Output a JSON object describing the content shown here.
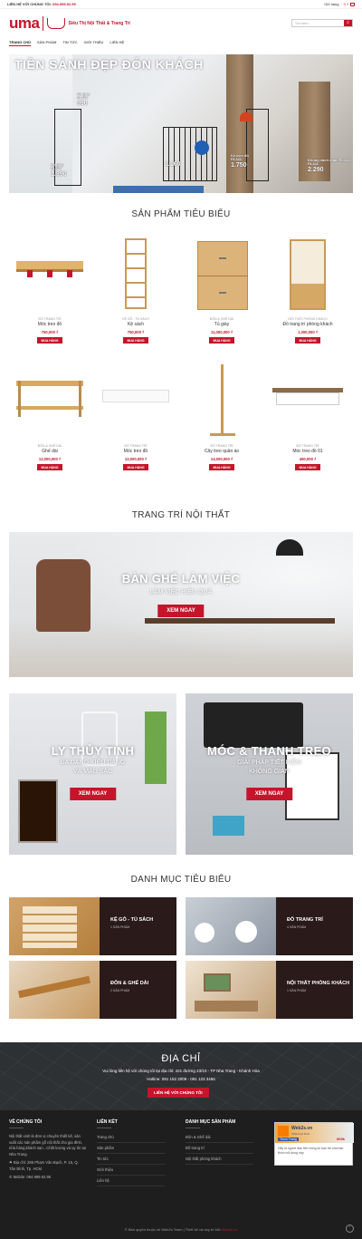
{
  "topbar": {
    "contact_label": "LIÊN HỆ VỚI CHÚNG TÔI:",
    "phone": "094.999.92.95",
    "cart_label": "Giỏ hàng",
    "cart_sep": "/",
    "cart_total": "0 ₫"
  },
  "header": {
    "logo": "uma",
    "tagline": "Siêu Thị Nội Thất & Trang Trí",
    "search_placeholder": "Tìm kiếm..."
  },
  "nav": {
    "items": [
      "TRANG CHỦ",
      "SẢN PHẨM",
      "TIN TỨC",
      "GIỚI THIỆU",
      "LIÊN HỆ"
    ]
  },
  "hero": {
    "title": "TIỀN SẢNH ĐẸP ĐÓN KHÁCH",
    "tags": [
      {
        "line1": "Kệ giày",
        "line2": "RL341",
        "price": "990"
      },
      {
        "line1": "Kệ giày",
        "line2": "RL341",
        "price": "1.390"
      },
      {
        "line1": "",
        "line2": "",
        "price": "1.160"
      },
      {
        "line1": "Kệ treo đồ",
        "line2": "RL341",
        "price": "1.750"
      },
      {
        "line1": "Khung vách ngăn RL341",
        "line2": "RL341",
        "price": "2.290"
      }
    ]
  },
  "featured": {
    "title": "SẢN PHẨM TIÊU BIỂU",
    "buy_label": "MUA HÀNG",
    "products": [
      {
        "cat": "ĐỒ TRANG TRÍ",
        "name": "Móc treo đồ",
        "price": "750,000 ₫"
      },
      {
        "cat": "KỆ GỖ - TỦ SÁCH",
        "name": "Kệ sách",
        "price": "750,000 ₫"
      },
      {
        "cat": "ĐÔN & GHẾ DÀI",
        "name": "Tủ giày",
        "price": "11,000,000 ₫"
      },
      {
        "cat": "NỘI THẤT PHÒNG KHÁCH",
        "name": "Đồ trang trí phòng khách",
        "price": "1,300,000 ₫"
      },
      {
        "cat": "ĐÔN & GHẾ DÀI",
        "name": "Ghế dài",
        "price": "12,000,000 ₫"
      },
      {
        "cat": "ĐỒ TRANG TRÍ",
        "name": "Móc treo đồ",
        "price": "12,000,000 ₫"
      },
      {
        "cat": "ĐỒ TRANG TRÍ",
        "name": "Cây treo quần áo",
        "price": "14,000,000 ₫"
      },
      {
        "cat": "ĐỒ TRANG TRÍ",
        "name": "Móc treo đồ 01",
        "price": "450,000 ₫"
      }
    ]
  },
  "decor": {
    "title": "TRANG TRÍ NỘI THẤT",
    "banner_main": {
      "title": "BÀN GHẾ LÀM VIỆC",
      "sub": "LÀM VIỆC HIỆU QUẢ",
      "btn": "XEM NGAY"
    },
    "banner_left": {
      "title": "LY THỦY TINH",
      "sub1": "ĐA DẠNG KIỂU DÁNG",
      "sub2": "VÀ MÀU SẮC",
      "btn": "XEM NGAY"
    },
    "banner_right": {
      "title": "MÓC & THANH TREO",
      "sub1": "GIẢI PHÁP TIẾT KIỆM",
      "sub2": "KHÔNG GIAN",
      "btn": "XEM NGAY"
    }
  },
  "categories": {
    "title": "DANH MỤC TIÊU BIỂU",
    "items": [
      {
        "name": "KỆ GỖ - TỦ SÁCH",
        "count": "1 SẢN PHẨM"
      },
      {
        "name": "ĐỒ TRANG TRÍ",
        "count": "4 SẢN PHẨM"
      },
      {
        "name": "ĐÔN & GHẾ DÀI",
        "count": "2 SẢN PHẨM"
      },
      {
        "name": "NỘI THẤT PHÒNG KHÁCH",
        "count": "1 SẢN PHẨM"
      }
    ]
  },
  "address": {
    "title": "ĐỊA CHỈ",
    "text": "Vui lòng liên hệ với chúng tôi tại địa chỉ: 421 đường 23/10 - TP Nha Trang - Khánh Hòa",
    "hotline": "Hotline: 091 152 2009 - 091 123 3456",
    "btn": "LIÊN HỆ VỚI CHÚNG TÔI"
  },
  "footer": {
    "about_title": "VỀ CHÚNG TÔI",
    "about_text": "Nội thất xinh là đơn vị chuyên thiết kế, sản xuất các sản phẩm gỗ nội thất cho gia đình, nhà hàng,khách sạn...Chất lượng và uy tín tại Nha Trang.",
    "address": "Địa chỉ: 285 Phạm Văn Bạch, P. 15, Q. Tân Bình, Tp. HCM",
    "mobile": "Mobile: 094.999.92.95",
    "links_title": "LIÊN KẾT",
    "links": [
      "Trang chủ",
      "Sản phẩm",
      "Tin tức",
      "Giới thiệu",
      "Liên hệ"
    ],
    "cats_title": "DANH MỤC SẢN PHẨM",
    "cats": [
      "Đôn & Ghế dài",
      "Đồ trang trí",
      "Nội thất phòng khách"
    ],
    "widget": {
      "site": "Web2s.vn",
      "line1": "4790 lượt thích",
      "like": "Thích Trang",
      "price": "600k",
      "note": "Hãy là người đầu tiên trong số bạn bè của bạn thích nội dung này"
    },
    "copyright": "© Bản quyền thuộc về Web2s Team | Thiết kế và duy trì bởi",
    "credit": "Web2s.vn"
  }
}
